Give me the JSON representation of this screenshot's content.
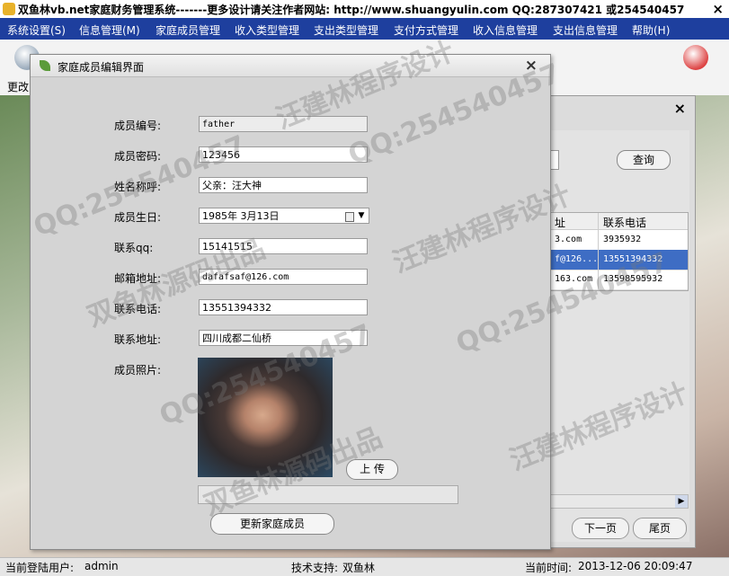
{
  "window": {
    "title": "双鱼林vb.net家庭财务管理系统-------更多设计请关注作者网站:   http://www.shuangyulin.com  QQ:287307421 或254540457"
  },
  "menu": [
    "系统设置(S)",
    "信息管理(M)",
    "家庭成员管理",
    "收入类型管理",
    "支出类型管理",
    "支付方式管理",
    "收入信息管理",
    "支出信息管理",
    "帮助(H)"
  ],
  "toolbar": {
    "label": "更改"
  },
  "dialog": {
    "title": "家庭成员编辑界面",
    "fields": {
      "id_label": "成员编号:",
      "id_value": "father",
      "password_label": "成员密码:",
      "password_value": "123456",
      "name_label": "姓名称呼:",
      "name_value": "父亲：汪大神",
      "birthday_label": "成员生日:",
      "birthday_value": "1985年  3月13日",
      "qq_label": "联系qq:",
      "qq_value": "15141515",
      "email_label": "邮箱地址:",
      "email_value": "dafafsaf@126.com",
      "phone_label": "联系电话:",
      "phone_value": "13551394332",
      "address_label": "联系地址:",
      "address_value": "四川成都二仙桥",
      "photo_label": "成员照片:"
    },
    "upload_label": "上  传",
    "update_label": "更新家庭成员"
  },
  "background_window": {
    "query_label": "查询",
    "columns": [
      "址",
      "联系电话"
    ],
    "rows": [
      [
        "3.com",
        "3935932"
      ],
      [
        "f@126...",
        "13551394332"
      ],
      [
        "163.com",
        "13598595932"
      ]
    ],
    "next_label": "下一页",
    "last_label": "尾页"
  },
  "status": {
    "user_label": "当前登陆用户:",
    "user_value": "admin",
    "support_label": "技术支持:",
    "support_value": "双鱼林",
    "time_label": "当前时间:",
    "time_value": "2013-12-06 20:09:47"
  },
  "watermarks": [
    "QQ:254540457",
    "汪建林程序设计",
    "双鱼林源码出品"
  ],
  "colors": {
    "menubar": "#1e3f9e",
    "selected_row": "#3e6dc4",
    "dialog_bg": "#d4d4d4"
  }
}
